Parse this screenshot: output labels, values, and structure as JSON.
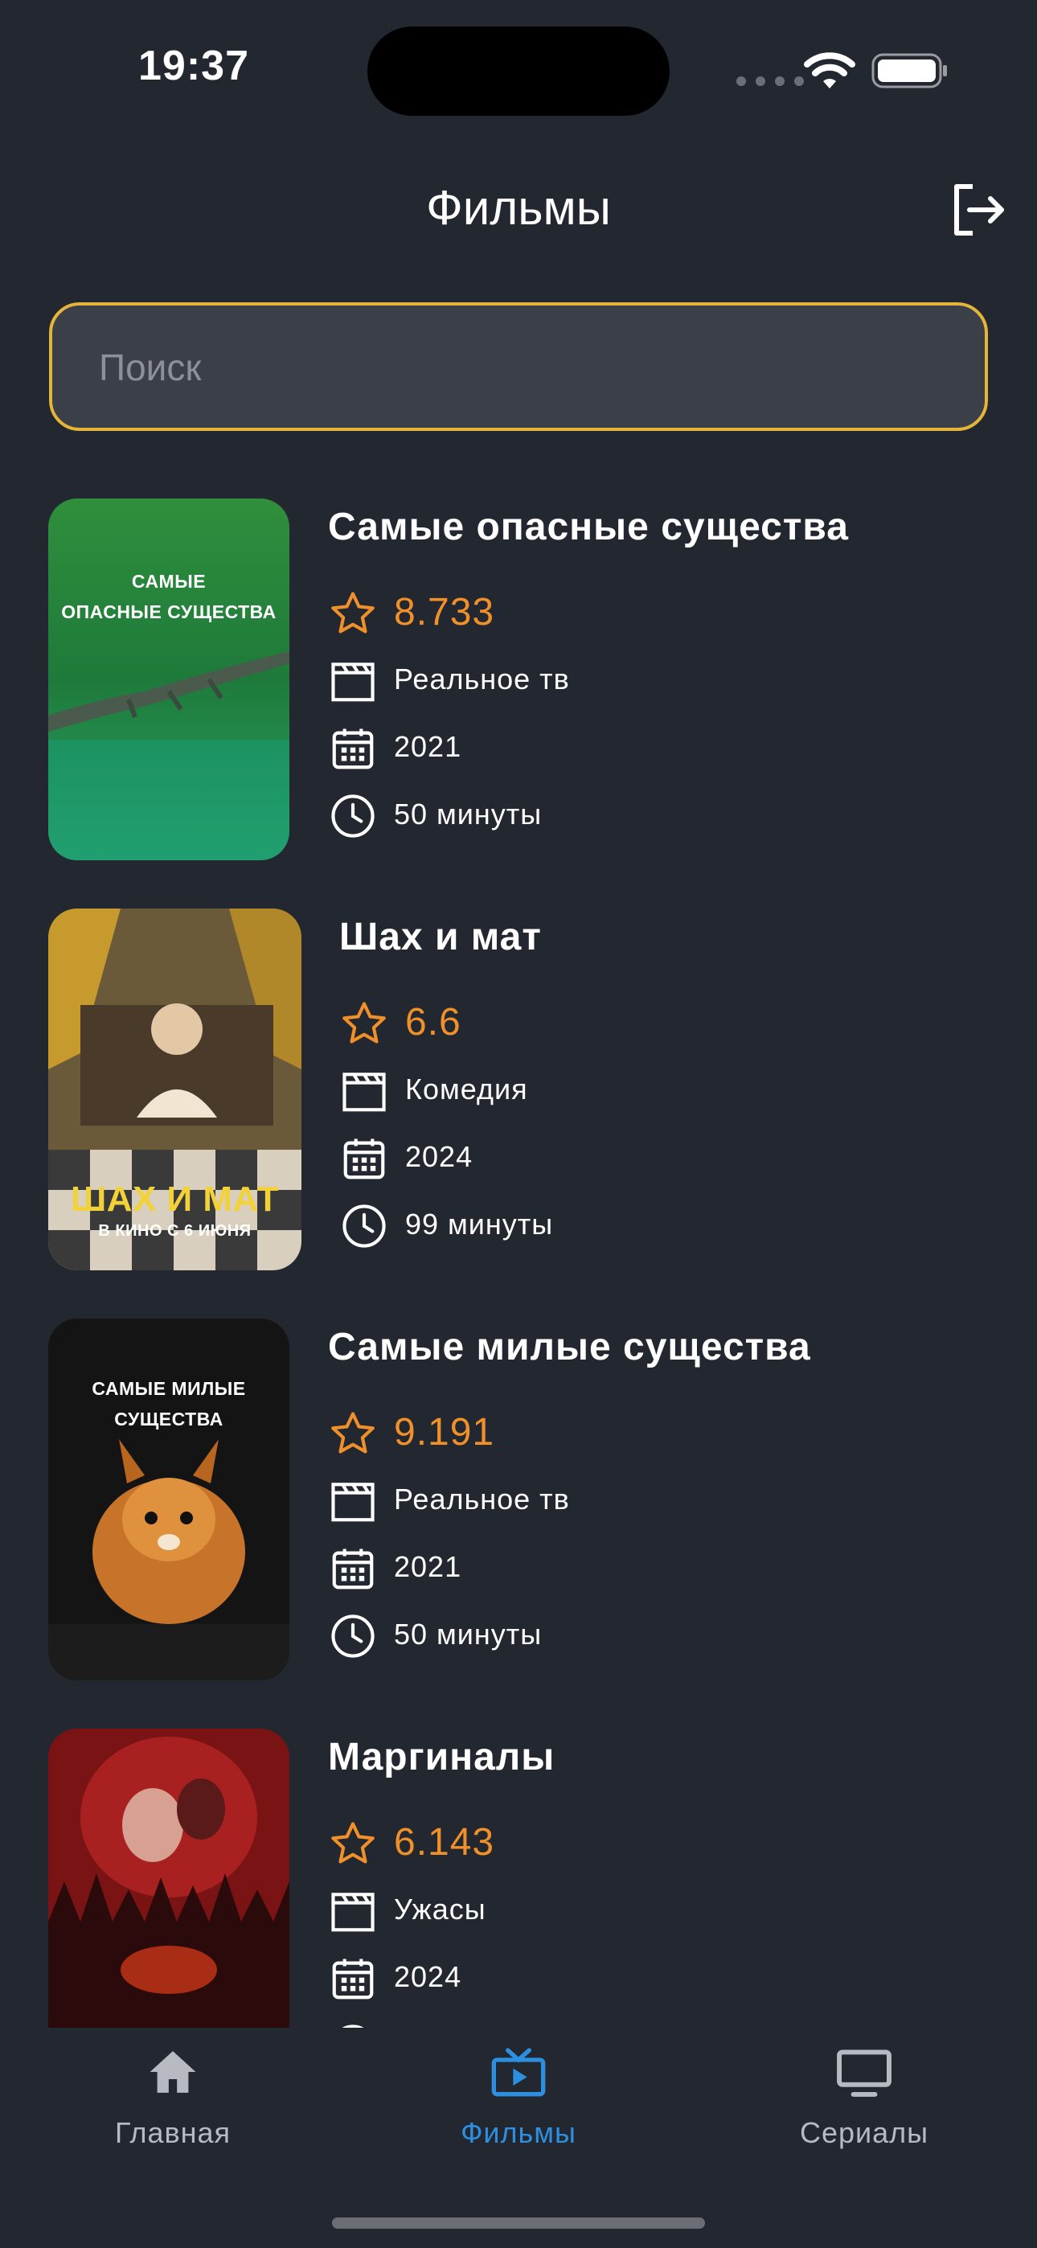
{
  "status_bar": {
    "time": "19:37"
  },
  "header": {
    "title": "Фильмы"
  },
  "search": {
    "placeholder": "Поиск",
    "border_color": "#e5b53a"
  },
  "movies": [
    {
      "title": "Самые опасные существа",
      "rating": "8.733",
      "genre": "Реальное тв",
      "year": "2021",
      "duration": "50 минуты",
      "poster_text": [
        "САМЫЕ",
        "ОПАСНЫЕ СУЩЕСТВА"
      ]
    },
    {
      "title": "Шах и мат",
      "rating": "6.6",
      "genre": "Комедия",
      "year": "2024",
      "duration": "99 минуты",
      "poster_text": [
        "ШАХ И МАТ",
        "В КИНО С 6 ИЮНЯ"
      ]
    },
    {
      "title": "Самые милые существа",
      "rating": "9.191",
      "genre": "Реальное тв",
      "year": "2021",
      "duration": "50 минуты",
      "poster_text": [
        "САМЫЕ МИЛЫЕ",
        "СУЩЕСТВА"
      ]
    },
    {
      "title": "Маргиналы",
      "rating": "6.143",
      "genre": "Ужасы",
      "year": "2024",
      "duration": "",
      "poster_text": []
    }
  ],
  "tabs": [
    {
      "label": "Главная",
      "icon": "home-icon",
      "active": false
    },
    {
      "label": "Фильмы",
      "icon": "tv-play-icon",
      "active": true
    },
    {
      "label": "Сериалы",
      "icon": "monitor-icon",
      "active": false
    }
  ],
  "colors": {
    "background": "#232730",
    "accent_rating": "#f0902a",
    "active_tab": "#2d8fe0",
    "inactive_tab": "#b7bac1"
  }
}
